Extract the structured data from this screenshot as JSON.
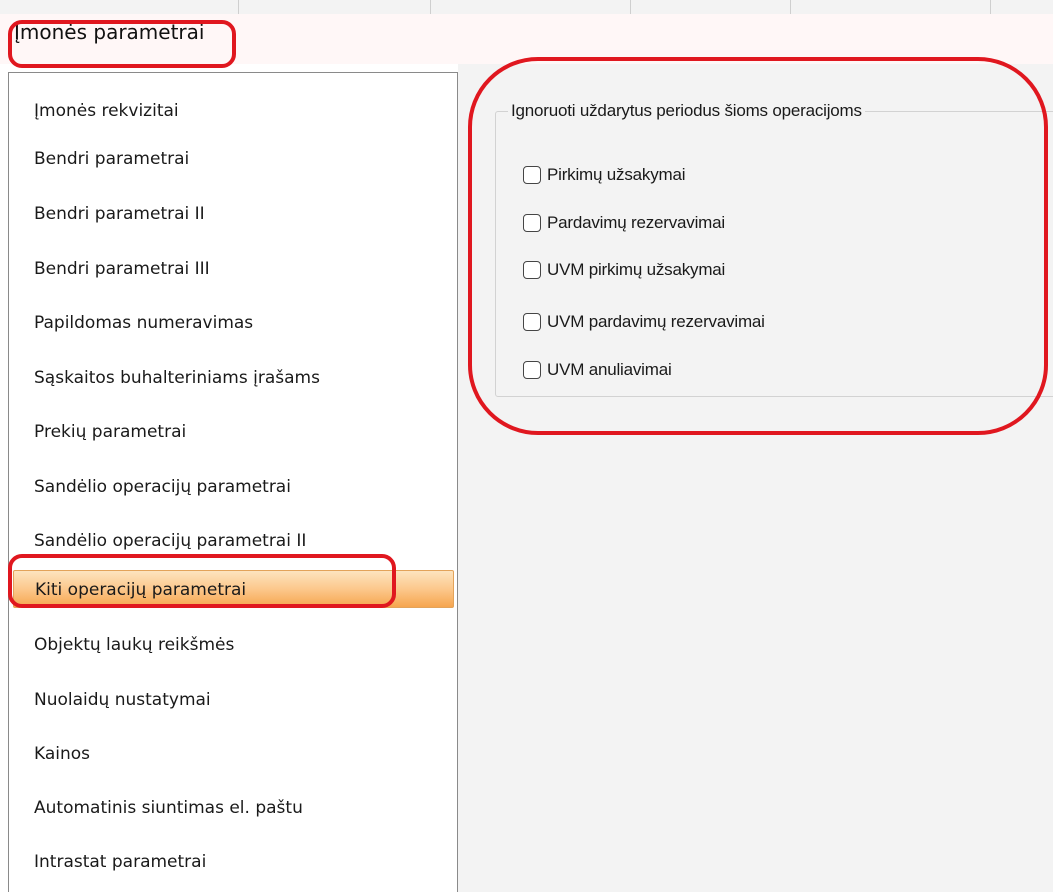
{
  "window": {
    "title": "Įmonės parametrai"
  },
  "nav": {
    "items": [
      {
        "label": "Įmonės rekvizitai"
      },
      {
        "label": "Bendri parametrai"
      },
      {
        "label": "Bendri parametrai II"
      },
      {
        "label": "Bendri parametrai III"
      },
      {
        "label": "Papildomas numeravimas"
      },
      {
        "label": "Sąskaitos buhalteriniams įrašams"
      },
      {
        "label": "Prekių parametrai"
      },
      {
        "label": "Sandėlio operacijų parametrai"
      },
      {
        "label": "Sandėlio operacijų parametrai II"
      },
      {
        "label": "Kiti operacijų parametrai",
        "selected": true
      },
      {
        "label": "Objektų laukų reikšmės"
      },
      {
        "label": "Nuolaidų nustatymai"
      },
      {
        "label": "Kainos"
      },
      {
        "label": "Automatinis siuntimas el. paštu"
      },
      {
        "label": "Intrastat parametrai"
      }
    ]
  },
  "group": {
    "title": "Ignoruoti uždarytus periodus šioms operacijoms",
    "checkboxes": [
      {
        "label": "Pirkimų užsakymai",
        "checked": false
      },
      {
        "label": "Pardavimų rezervavimai",
        "checked": false
      },
      {
        "label": "UVM pirkimų užsakymai",
        "checked": false
      },
      {
        "label": "UVM pardavimų rezervavimai",
        "checked": false
      },
      {
        "label": "UVM anuliavimai",
        "checked": false
      }
    ]
  },
  "colors": {
    "highlight": "#e0171f",
    "selected_gradient_top": "#fde4bf",
    "selected_gradient_bottom": "#f6a54f",
    "panel_background": "#f3f3f3"
  }
}
